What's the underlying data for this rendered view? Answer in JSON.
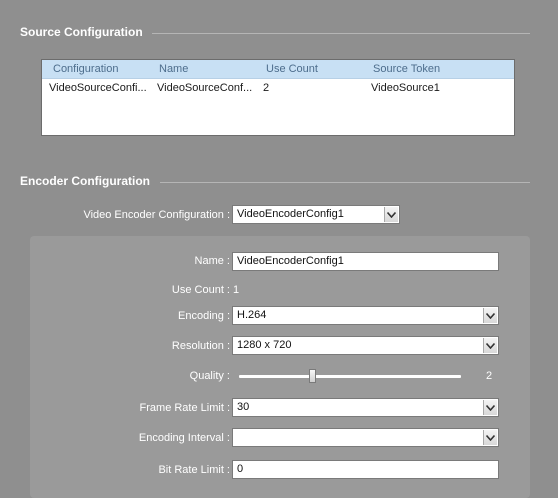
{
  "source": {
    "title": "Source Configuration",
    "columns": [
      "Configuration",
      "Name",
      "Use Count",
      "Source Token"
    ],
    "rows": [
      [
        "VideoSourceConfi...",
        "VideoSourceConf...",
        "2",
        "VideoSource1"
      ]
    ]
  },
  "encoder": {
    "title": "Encoder Configuration",
    "selector_label": "Video Encoder Configuration :",
    "selector_value": "VideoEncoderConfig1",
    "name_label": "Name :",
    "name_value": "VideoEncoderConfig1",
    "use_count_label": "Use Count :",
    "use_count_value": "1",
    "encoding_label": "Encoding :",
    "encoding_value": "H.264",
    "resolution_label": "Resolution :",
    "resolution_value": "1280 x 720",
    "quality_label": "Quality :",
    "quality_value": "2",
    "quality_fraction": 0.33,
    "frame_rate_label": "Frame Rate Limit :",
    "frame_rate_value": "30",
    "interval_label": "Encoding Interval :",
    "interval_value": "",
    "bitrate_label": "Bit Rate Limit :",
    "bitrate_value": "0"
  }
}
